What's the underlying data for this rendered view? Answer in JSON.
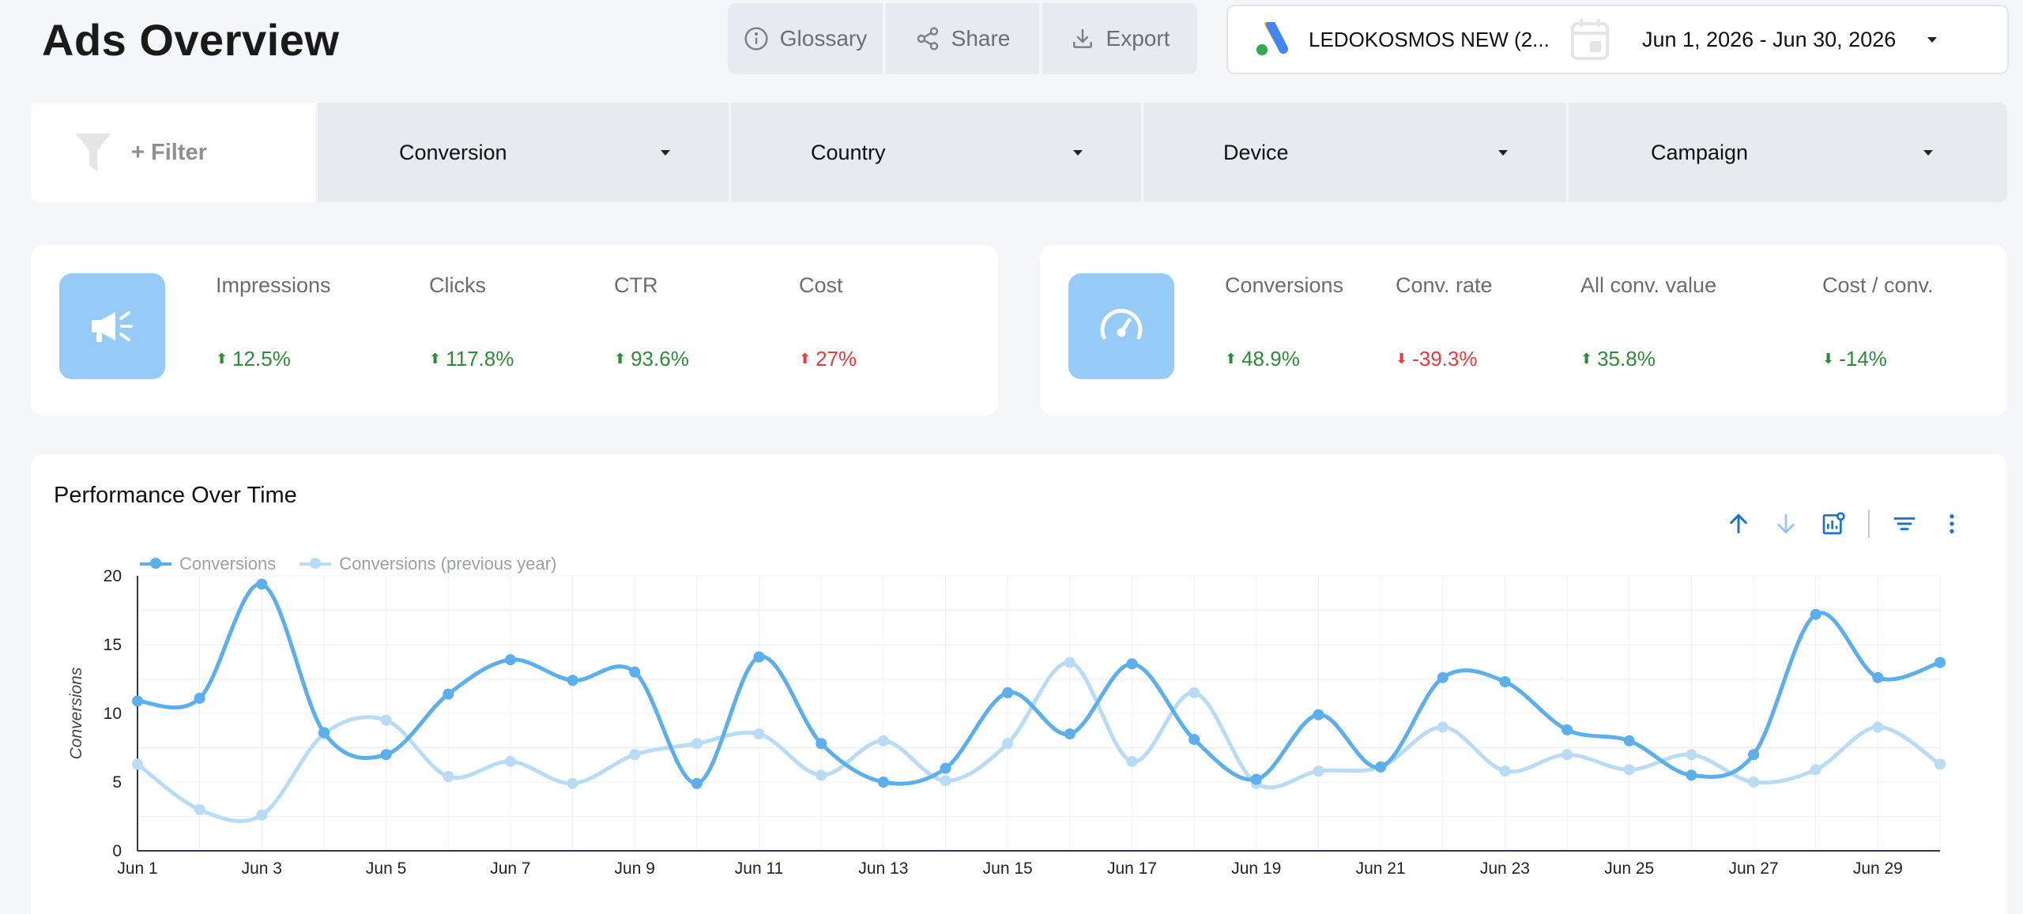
{
  "header": {
    "title": "Ads Overview",
    "buttons": {
      "glossary": "Glossary",
      "share": "Share",
      "export": "Export"
    },
    "account_name": "LEDOKOSMOS NEW (2...",
    "date_range": "Jun 1, 2026 - Jun 30, 2026"
  },
  "filters": {
    "add_label": "+ Filter",
    "dropdowns": [
      "Conversion",
      "Country",
      "Device",
      "Campaign"
    ]
  },
  "kpi_left": {
    "icon": "megaphone-icon",
    "metrics": [
      {
        "label": "Impressions",
        "delta": "12.5%",
        "direction": "up",
        "sentiment": "good"
      },
      {
        "label": "Clicks",
        "delta": "117.8%",
        "direction": "up",
        "sentiment": "good"
      },
      {
        "label": "CTR",
        "delta": "93.6%",
        "direction": "up",
        "sentiment": "good"
      },
      {
        "label": "Cost",
        "delta": "27%",
        "direction": "up",
        "sentiment": "bad"
      }
    ]
  },
  "kpi_right": {
    "icon": "gauge-icon",
    "metrics": [
      {
        "label": "Conversions",
        "delta": "48.9%",
        "direction": "up",
        "sentiment": "good"
      },
      {
        "label": "Conv. rate",
        "delta": "-39.3%",
        "direction": "down",
        "sentiment": "bad"
      },
      {
        "label": "All conv. value",
        "delta": "35.8%",
        "direction": "up",
        "sentiment": "good"
      },
      {
        "label": "Cost / conv.",
        "delta": "-14%",
        "direction": "down",
        "sentiment": "good"
      }
    ]
  },
  "colors": {
    "good": "#2e8b3a",
    "bad": "#e63c3c",
    "accent": "#5aafec",
    "accent_light": "#b9dcf6",
    "tool_blue": "#1a73c9"
  },
  "chart": {
    "title": "Performance Over Time"
  },
  "chart_data": {
    "type": "line",
    "title": "Performance Over Time",
    "ylabel": "Conversions",
    "xlabel": "",
    "ylim": [
      0,
      20
    ],
    "yticks": [
      0,
      5,
      10,
      15,
      20
    ],
    "x": [
      "Jun 1",
      "Jun 2",
      "Jun 3",
      "Jun 4",
      "Jun 5",
      "Jun 6",
      "Jun 7",
      "Jun 8",
      "Jun 9",
      "Jun 10",
      "Jun 11",
      "Jun 12",
      "Jun 13",
      "Jun 14",
      "Jun 15",
      "Jun 16",
      "Jun 17",
      "Jun 18",
      "Jun 19",
      "Jun 20",
      "Jun 21",
      "Jun 22",
      "Jun 23",
      "Jun 24",
      "Jun 25",
      "Jun 26",
      "Jun 27",
      "Jun 28",
      "Jun 29",
      "Jun 30"
    ],
    "xtick_labels": [
      "Jun 1",
      "Jun 3",
      "Jun 5",
      "Jun 7",
      "Jun 9",
      "Jun 11",
      "Jun 13",
      "Jun 15",
      "Jun 17",
      "Jun 19",
      "Jun 21",
      "Jun 23",
      "Jun 25",
      "Jun 27",
      "Jun 29"
    ],
    "series": [
      {
        "name": "Conversions",
        "color": "#5aafec",
        "values": [
          10.9,
          11.1,
          19.4,
          8.6,
          7.0,
          11.4,
          13.9,
          12.4,
          13.0,
          4.9,
          14.1,
          7.8,
          5.0,
          6.0,
          11.5,
          8.5,
          13.6,
          8.1,
          5.2,
          9.9,
          6.1,
          12.6,
          12.3,
          8.8,
          8.0,
          5.5,
          7.0,
          17.2,
          12.6,
          13.7
        ]
      },
      {
        "name": "Conversions (previous year)",
        "color": "#b9dcf6",
        "values": [
          6.3,
          3.0,
          2.6,
          8.5,
          9.5,
          5.4,
          6.5,
          4.9,
          7.0,
          7.8,
          8.5,
          5.5,
          8.0,
          5.1,
          7.8,
          13.7,
          6.5,
          11.5,
          4.9,
          5.8,
          6.1,
          9.0,
          5.8,
          7.0,
          5.9,
          7.0,
          5.0,
          5.9,
          9.0,
          6.3
        ]
      }
    ],
    "legend": "top-left",
    "grid": true
  }
}
